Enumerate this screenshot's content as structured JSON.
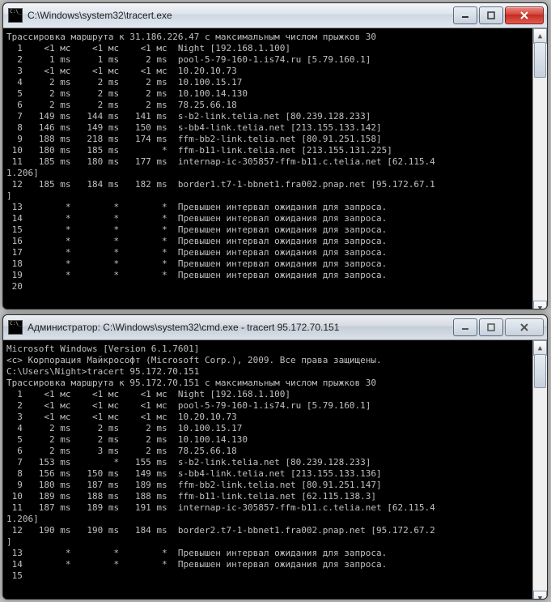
{
  "window1": {
    "title": "C:\\Windows\\system32\\tracert.exe",
    "header": "Трассировка маршрута к 31.186.226.47 с максимальным числом прыжков 30",
    "rows": [
      {
        "n": "1",
        "c1": "<1 мс",
        "c2": "<1 мс",
        "c3": "<1 мс",
        "host": "Night [192.168.1.100]"
      },
      {
        "n": "2",
        "c1": "1 ms",
        "c2": "1 ms",
        "c3": "2 ms",
        "host": "pool-5-79-160-1.is74.ru [5.79.160.1]"
      },
      {
        "n": "3",
        "c1": "<1 мс",
        "c2": "<1 мс",
        "c3": "<1 мс",
        "host": "10.20.10.73"
      },
      {
        "n": "4",
        "c1": "2 ms",
        "c2": "2 ms",
        "c3": "2 ms",
        "host": "10.100.15.17"
      },
      {
        "n": "5",
        "c1": "2 ms",
        "c2": "2 ms",
        "c3": "2 ms",
        "host": "10.100.14.130"
      },
      {
        "n": "6",
        "c1": "2 ms",
        "c2": "2 ms",
        "c3": "2 ms",
        "host": "78.25.66.18"
      },
      {
        "n": "7",
        "c1": "149 ms",
        "c2": "144 ms",
        "c3": "141 ms",
        "host": "s-b2-link.telia.net [80.239.128.233]"
      },
      {
        "n": "8",
        "c1": "146 ms",
        "c2": "149 ms",
        "c3": "150 ms",
        "host": "s-bb4-link.telia.net [213.155.133.142]"
      },
      {
        "n": "9",
        "c1": "188 ms",
        "c2": "218 ms",
        "c3": "174 ms",
        "host": "ffm-bb2-link.telia.net [80.91.251.158]"
      },
      {
        "n": "10",
        "c1": "180 ms",
        "c2": "185 ms",
        "c3": "*",
        "host": "ffm-b11-link.telia.net [213.155.131.225]"
      },
      {
        "n": "11",
        "c1": "185 ms",
        "c2": "180 ms",
        "c3": "177 ms",
        "host": "internap-ic-305857-ffm-b11.c.telia.net [62.115.4"
      }
    ],
    "wrap1": "1.206]",
    "row12": {
      "n": "12",
      "c1": "185 ms",
      "c2": "184 ms",
      "c3": "182 ms",
      "host": "border1.t7-1-bbnet1.fra002.pnap.net [95.172.67.1"
    },
    "wrap2": "]",
    "timeouts": [
      {
        "n": "13",
        "msg": "Превышен интервал ожидания для запроса."
      },
      {
        "n": "14",
        "msg": "Превышен интервал ожидания для запроса."
      },
      {
        "n": "15",
        "msg": "Превышен интервал ожидания для запроса."
      },
      {
        "n": "16",
        "msg": "Превышен интервал ожидания для запроса."
      },
      {
        "n": "17",
        "msg": "Превышен интервал ожидания для запроса."
      },
      {
        "n": "18",
        "msg": "Превышен интервал ожидания для запроса."
      },
      {
        "n": "19",
        "msg": "Превышен интервал ожидания для запроса."
      }
    ],
    "last": "20"
  },
  "window2": {
    "title": "Администратор: C:\\Windows\\system32\\cmd.exe - tracert  95.172.70.151",
    "line1": "Microsoft Windows [Version 6.1.7601]",
    "line2": "<c> Корпорация Майкрософт (Microsoft Corp.), 2009. Все права защищены.",
    "prompt": "C:\\Users\\Night>tracert 95.172.70.151",
    "header": "Трассировка маршрута к 95.172.70.151 с максимальным числом прыжков 30",
    "rows": [
      {
        "n": "1",
        "c1": "<1 мс",
        "c2": "<1 мс",
        "c3": "<1 мс",
        "host": "Night [192.168.1.100]"
      },
      {
        "n": "2",
        "c1": "<1 мс",
        "c2": "<1 мс",
        "c3": "<1 мс",
        "host": "pool-5-79-160-1.is74.ru [5.79.160.1]"
      },
      {
        "n": "3",
        "c1": "<1 мс",
        "c2": "<1 мс",
        "c3": "<1 мс",
        "host": "10.20.10.73"
      },
      {
        "n": "4",
        "c1": "2 ms",
        "c2": "2 ms",
        "c3": "2 ms",
        "host": "10.100.15.17"
      },
      {
        "n": "5",
        "c1": "2 ms",
        "c2": "2 ms",
        "c3": "2 ms",
        "host": "10.100.14.130"
      },
      {
        "n": "6",
        "c1": "2 ms",
        "c2": "3 ms",
        "c3": "2 ms",
        "host": "78.25.66.18"
      },
      {
        "n": "7",
        "c1": "153 ms",
        "c2": "*",
        "c3": "155 ms",
        "host": "s-b2-link.telia.net [80.239.128.233]"
      },
      {
        "n": "8",
        "c1": "156 ms",
        "c2": "150 ms",
        "c3": "149 ms",
        "host": "s-bb4-link.telia.net [213.155.133.136]"
      },
      {
        "n": "9",
        "c1": "180 ms",
        "c2": "187 ms",
        "c3": "189 ms",
        "host": "ffm-bb2-link.telia.net [80.91.251.147]"
      },
      {
        "n": "10",
        "c1": "189 ms",
        "c2": "188 ms",
        "c3": "188 ms",
        "host": "ffm-b11-link.telia.net [62.115.138.3]"
      },
      {
        "n": "11",
        "c1": "187 ms",
        "c2": "189 ms",
        "c3": "191 ms",
        "host": "internap-ic-305857-ffm-b11.c.telia.net [62.115.4"
      }
    ],
    "wrap1": "1.206]",
    "row12": {
      "n": "12",
      "c1": "190 ms",
      "c2": "190 ms",
      "c3": "184 ms",
      "host": "border2.t7-1-bbnet1.fra002.pnap.net [95.172.67.2"
    },
    "wrap2": "]",
    "timeouts": [
      {
        "n": "13",
        "msg": "Превышен интервал ожидания для запроса."
      },
      {
        "n": "14",
        "msg": "Превышен интервал ожидания для запроса."
      }
    ],
    "last": "15"
  }
}
